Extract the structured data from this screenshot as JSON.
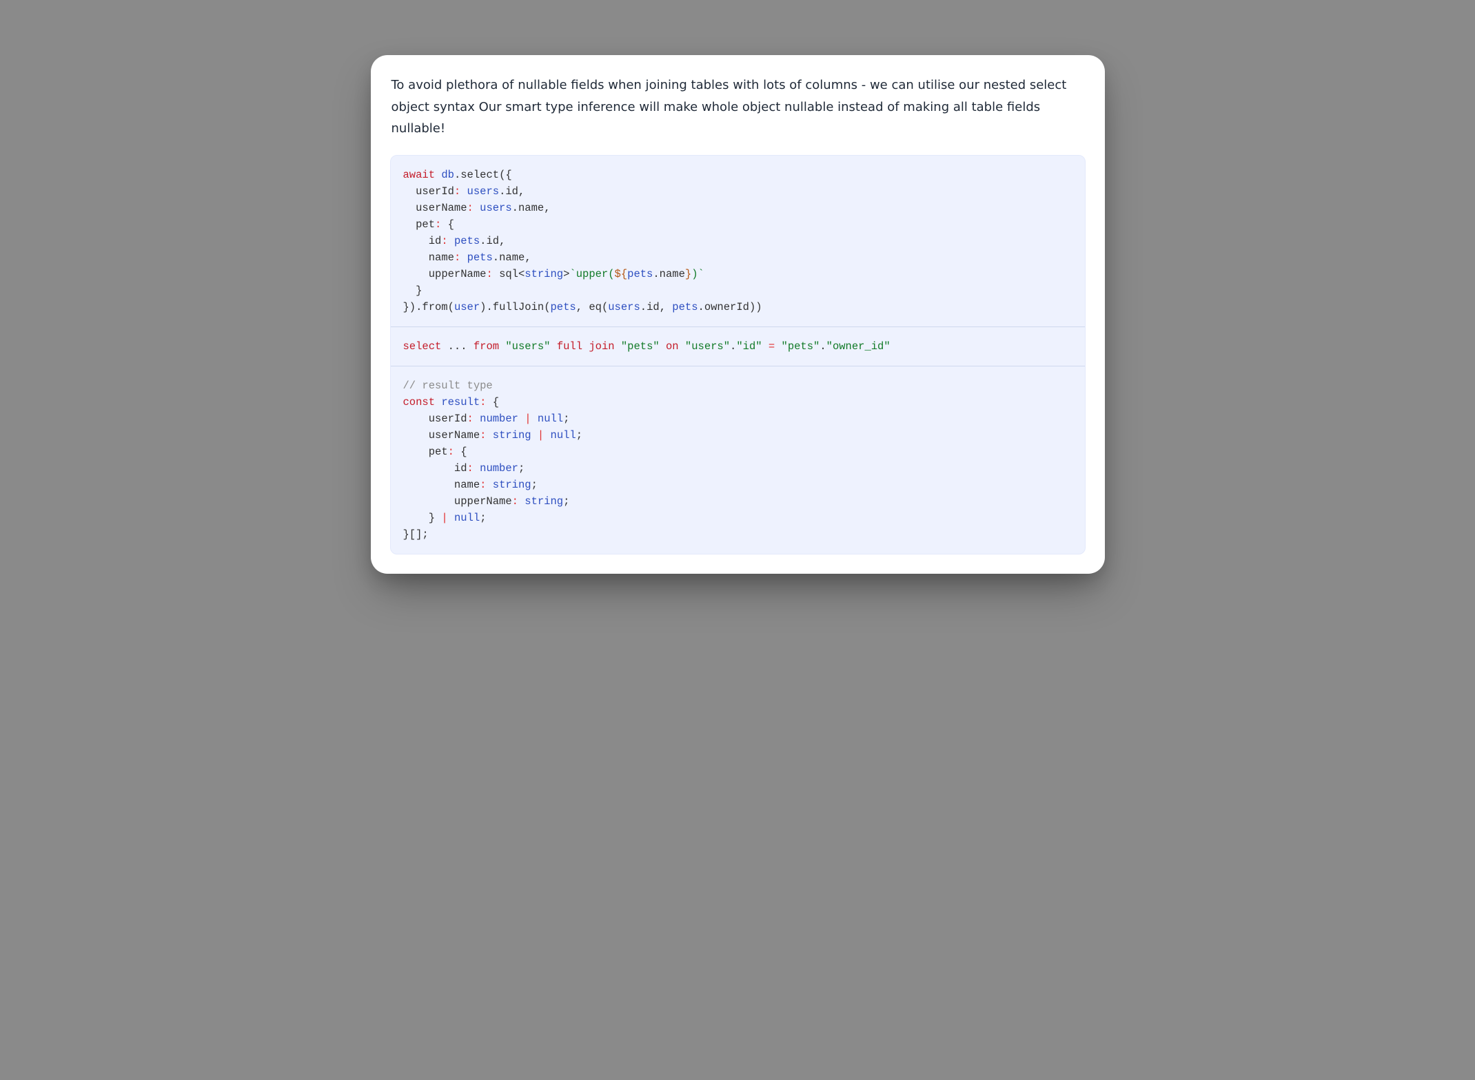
{
  "intro": "To avoid plethora of nullable fields when joining tables with lots of columns - we can utilise our nested select object syntax Our smart type inference will make whole object nullable instead of making all table fields nullable!",
  "code": {
    "block1": {
      "l1": {
        "kw": "await",
        "sp": " ",
        "db": "db",
        "dot": ".",
        "sel": "select",
        "open": "({"
      },
      "l2": {
        "indent": "  ",
        "key": "userId",
        "colon": ":",
        "sp": " ",
        "obj": "users",
        "dot": ".",
        "prop": "id",
        "comma": ","
      },
      "l3": {
        "indent": "  ",
        "key": "userName",
        "colon": ":",
        "sp": " ",
        "obj": "users",
        "dot": ".",
        "prop": "name",
        "comma": ","
      },
      "l4": {
        "indent": "  ",
        "key": "pet",
        "colon": ":",
        "sp": " ",
        "brace": "{"
      },
      "l5": {
        "indent": "    ",
        "key": "id",
        "colon": ":",
        "sp": " ",
        "obj": "pets",
        "dot": ".",
        "prop": "id",
        "comma": ","
      },
      "l6": {
        "indent": "    ",
        "key": "name",
        "colon": ":",
        "sp": " ",
        "obj": "pets",
        "dot": ".",
        "prop": "name",
        "comma": ","
      },
      "l7": {
        "indent": "    ",
        "key": "upperName",
        "colon": ":",
        "sp": " ",
        "fn": "sql",
        "lt": "<",
        "typ": "string",
        "gt": ">",
        "tick1": "`",
        "tpl1": "upper(",
        "dol1": "${",
        "tobj": "pets",
        "tdot": ".",
        "tprop": "name",
        "dol2": "}",
        "tpl2": ")",
        "tick2": "`"
      },
      "l8": {
        "indent": "  ",
        "brace": "}"
      },
      "l9": {
        "close": "}).",
        "from": "from",
        "p1": "(",
        "arg1": "user",
        "p2": ").",
        "fj": "fullJoin",
        "p3": "(",
        "arg2": "pets",
        "comma": ", ",
        "eq": "eq",
        "p4": "(",
        "a": "users",
        "ad": ".",
        "ap": "id",
        "comma2": ", ",
        "b": "pets",
        "bd": ".",
        "bp": "ownerId",
        "p5": "))"
      }
    },
    "block2": {
      "l1": {
        "kw": "select",
        "sp": " ",
        "dots": "...",
        "sp2": " ",
        "from": "from",
        "sp3": " ",
        "s1": "\"users\"",
        "sp4": " ",
        "full": "full",
        "sp5": " ",
        "join": "join",
        "sp6": " ",
        "s2": "\"pets\"",
        "sp7": " ",
        "on": "on",
        "sp8": " ",
        "s3": "\"users\"",
        "dot1": ".",
        "s4": "\"id\"",
        "sp9": " ",
        "eq": "=",
        "sp10": " ",
        "s5": "\"pets\"",
        "dot2": ".",
        "s6": "\"owner_id\""
      }
    },
    "block3": {
      "l1": {
        "cmt": "// result type"
      },
      "l2": {
        "kw": "const",
        "sp": " ",
        "name": "result",
        "colon": ":",
        "sp2": " ",
        "brace": "{"
      },
      "l3": {
        "indent": "    ",
        "key": "userId",
        "colon": ":",
        "sp": " ",
        "t1": "number",
        "sp2": " ",
        "pipe": "|",
        "sp3": " ",
        "t2": "null",
        "semi": ";"
      },
      "l4": {
        "indent": "    ",
        "key": "userName",
        "colon": ":",
        "sp": " ",
        "t1": "string",
        "sp2": " ",
        "pipe": "|",
        "sp3": " ",
        "t2": "null",
        "semi": ";"
      },
      "l5": {
        "indent": "    ",
        "key": "pet",
        "colon": ":",
        "sp": " ",
        "brace": "{"
      },
      "l6": {
        "indent": "        ",
        "key": "id",
        "colon": ":",
        "sp": " ",
        "t1": "number",
        "semi": ";"
      },
      "l7": {
        "indent": "        ",
        "key": "name",
        "colon": ":",
        "sp": " ",
        "t1": "string",
        "semi": ";"
      },
      "l8": {
        "indent": "        ",
        "key": "upperName",
        "colon": ":",
        "sp": " ",
        "t1": "string",
        "semi": ";"
      },
      "l9": {
        "indent": "    ",
        "brace": "}",
        "sp": " ",
        "pipe": "|",
        "sp2": " ",
        "t": "null",
        "semi": ";"
      },
      "l10": {
        "brace": "}[];"
      }
    }
  }
}
